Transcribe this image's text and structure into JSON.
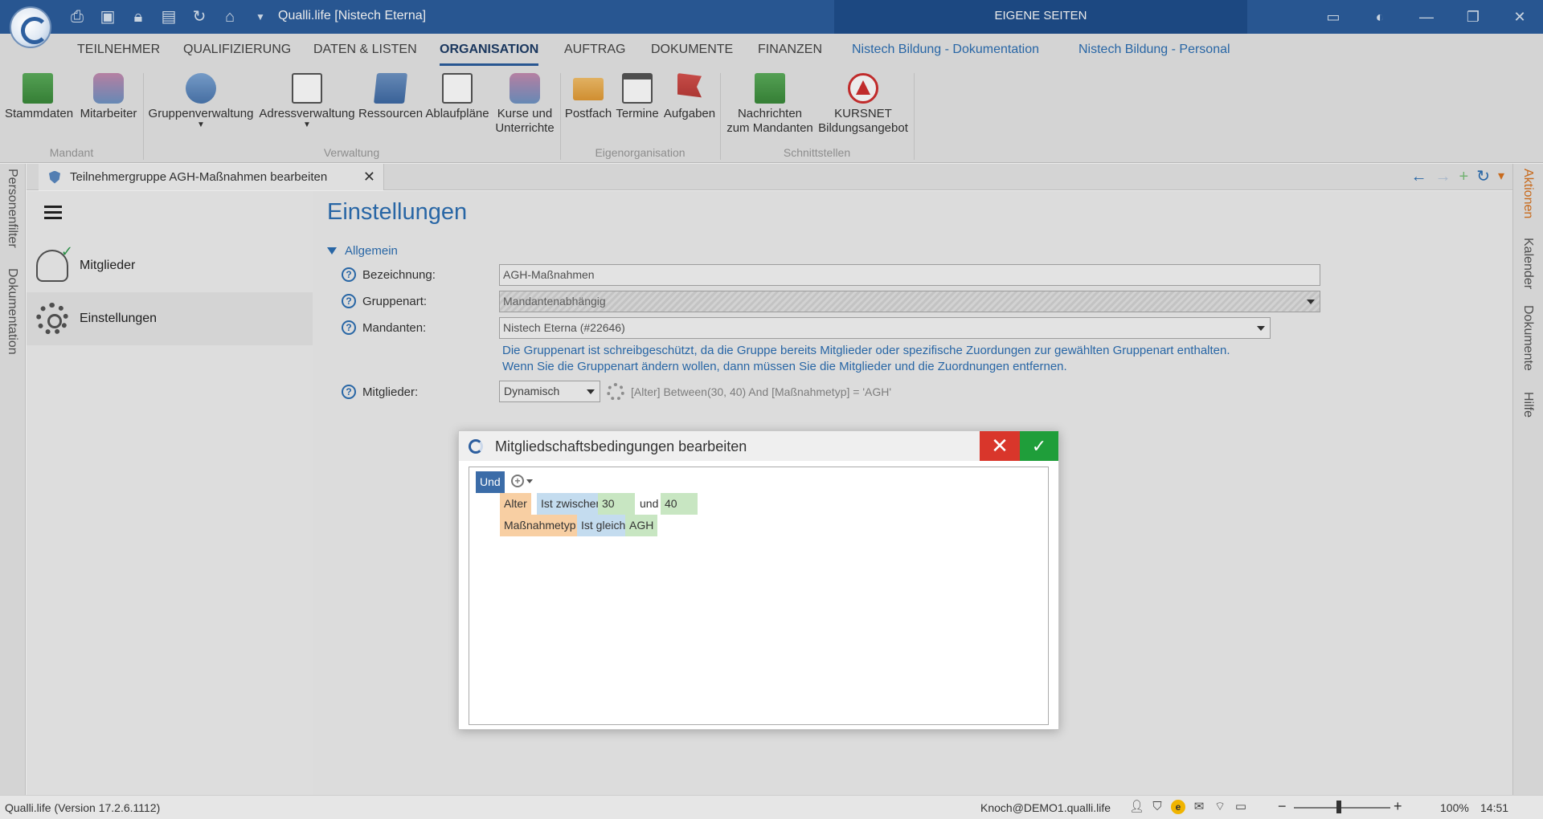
{
  "window": {
    "title": "Qualli.life [Nistech Eterna]",
    "context_title": "EIGENE SEITEN",
    "controls": [
      "▭",
      "◐",
      "—",
      "❐",
      "✕"
    ]
  },
  "quick_access": [
    "print-icon",
    "save-icon",
    "lock-icon",
    "save-as-icon",
    "refresh-icon",
    "home-icon",
    "customize-caret-icon"
  ],
  "menu": {
    "tabs": [
      {
        "label": "TEILNEHMER"
      },
      {
        "label": "QUALIFIZIERUNG"
      },
      {
        "label": "DATEN & LISTEN"
      },
      {
        "label": "ORGANISATION"
      },
      {
        "label": "AUFTRAG"
      },
      {
        "label": "DOKUMENTE"
      },
      {
        "label": "FINANZEN"
      },
      {
        "label": "Nistech Bildung - Dokumentation"
      },
      {
        "label": "Nistech Bildung - Personal"
      }
    ],
    "active": "ORGANISATION"
  },
  "ribbon": {
    "groups": {
      "mandant": "Mandant",
      "verwaltung": "Verwaltung",
      "eigenorganisation": "Eigenorganisation",
      "schnittstellen": "Schnittstellen"
    },
    "buttons": {
      "stammdaten": "Stammdaten",
      "mitarbeiter": "Mitarbeiter",
      "gruppenverwaltung": "Gruppenverwaltung",
      "adressverwaltung": "Adressverwaltung",
      "ressourcen": "Ressourcen",
      "ablaufplaene": "Ablaufpläne",
      "kurse_line1": "Kurse und",
      "kurse_line2": "Unterrichte",
      "postfach": "Postfach",
      "termine": "Termine",
      "aufgaben": "Aufgaben",
      "nachrichten_line1": "Nachrichten",
      "nachrichten_line2": "zum Mandanten",
      "kursnet_line1": "KURSNET",
      "kursnet_line2": "Bildungsangebot"
    }
  },
  "left_rail": {
    "personenfilter": "Personenfilter",
    "dokumentation": "Dokumentation"
  },
  "right_rail": {
    "aktionen": "Aktionen",
    "kalender": "Kalender",
    "dokumente": "Dokumente",
    "hilfe": "Hilfe"
  },
  "doc_tab": {
    "title": "Teilnehmergruppe AGH-Maßnahmen bearbeiten",
    "close": "✕"
  },
  "nav": {
    "back": "←",
    "forward": "→",
    "add": "+",
    "reload": "↻",
    "menu": "▾"
  },
  "sidebar": {
    "items": [
      {
        "label": "Mitglieder"
      },
      {
        "label": "Einstellungen"
      }
    ]
  },
  "settings": {
    "title": "Einstellungen",
    "section": "Allgemein",
    "fields": {
      "bezeichnung_label": "Bezeichnung:",
      "bezeichnung_value": "AGH-Maßnahmen",
      "gruppenart_label": "Gruppenart:",
      "gruppenart_value": "Mandantenabhängig",
      "mandanten_label": "Mandanten:",
      "mandanten_value": "Nistech Eterna (#22646)",
      "mitglieder_label": "Mitglieder:",
      "mitglieder_value": "Dynamisch",
      "condition_expr": "[Alter] Between(30, 40) And [Maßnahmetyp] = 'AGH'"
    },
    "info_line1": "Die Gruppenart ist schreibgeschützt, da die Gruppe bereits Mitglieder oder spezifische Zuordungen zur gewählten Gruppenart enthalten.",
    "info_line2": "Wenn Sie die Gruppenart ändern wollen, dann müssen Sie die Mitglieder und die Zuordnungen entfernen."
  },
  "dialog": {
    "title": "Mitgliedschaftsbedingungen bearbeiten",
    "cancel": "✕",
    "ok": "✓",
    "root_operator": "Und",
    "rules": [
      {
        "field": "Alter",
        "operator": "Ist zwischen",
        "value1": "30",
        "conj": "und",
        "value2": "40"
      },
      {
        "field": "Maßnahmetyp",
        "operator": "Ist gleich",
        "value1": "AGH"
      }
    ]
  },
  "statusbar": {
    "version": "Qualli.life (Version 17.2.6.1112)",
    "user": "Knoch@DEMO1.qualli.life",
    "zoom_minus": "−",
    "zoom_plus": "+",
    "zoom": "100%",
    "time": "14:51",
    "zoom_level": 0.45
  },
  "colors": {
    "accent": "#2c6fb4",
    "titlebar": "#2c5e9e",
    "cancel": "#d9362b",
    "ok": "#1f9e3a",
    "field_chip": "#f8cfa3",
    "operator_chip": "#c4dcef",
    "value_chip": "#c8e6c2"
  }
}
